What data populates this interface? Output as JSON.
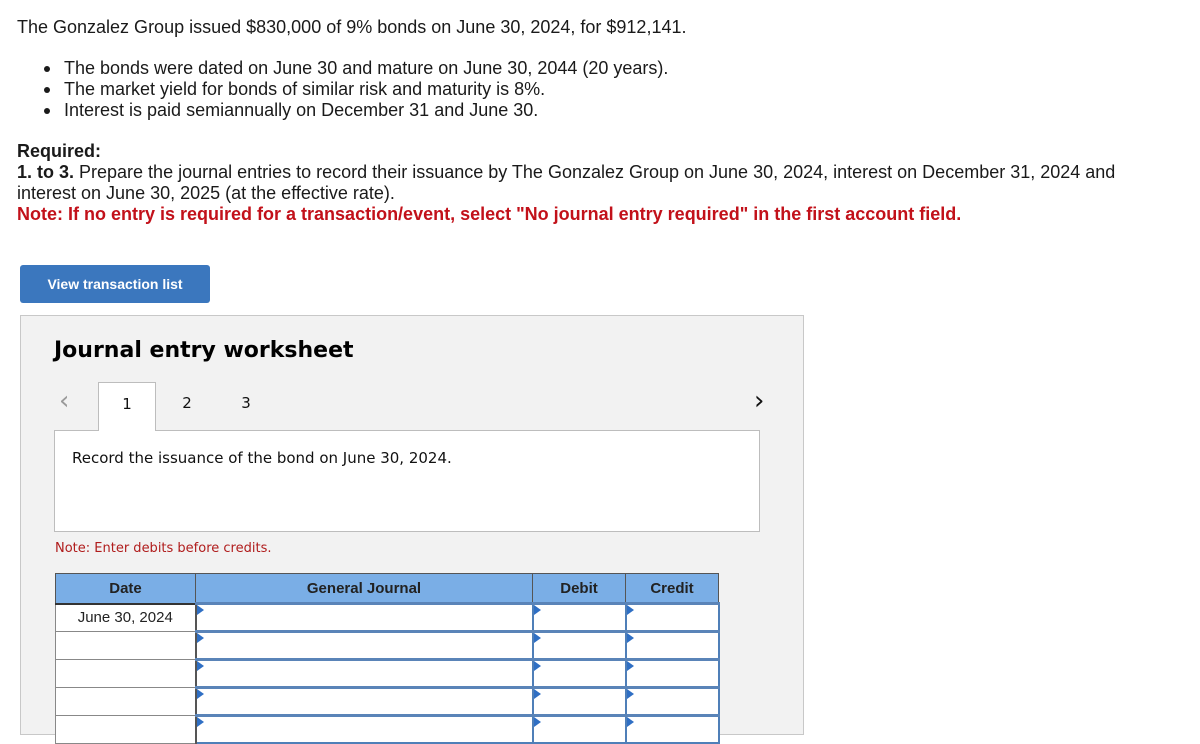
{
  "problem": {
    "intro": "The Gonzalez Group issued $830,000 of 9% bonds on June 30, 2024, for $912,141.",
    "bullets": [
      "The bonds were dated on June 30 and mature on June 30, 2044 (20 years).",
      "The market yield for bonds of similar risk and maturity is 8%.",
      "Interest is paid semiannually on December 31 and June 30."
    ],
    "required_heading": "Required:",
    "step_label": "1. to 3.",
    "step_text": " Prepare the journal entries to record their issuance by The Gonzalez Group on June 30, 2024, interest on December 31, 2024 and interest on June 30, 2025 (at the effective rate).",
    "note": "Note: If no entry is required for a transaction/event, select \"No journal entry required\" in the first account field."
  },
  "view_transaction_button": "View transaction list",
  "worksheet": {
    "title": "Journal entry worksheet",
    "prev_icon": "‹",
    "next_icon": "›",
    "tabs": [
      {
        "label": "1",
        "active": true
      },
      {
        "label": "2",
        "active": false
      },
      {
        "label": "3",
        "active": false
      }
    ],
    "description": "Record the issuance of the bond on June 30, 2024.",
    "note": "Note: Enter debits before credits.",
    "table": {
      "headers": [
        "Date",
        "General Journal",
        "Debit",
        "Credit"
      ],
      "rows": [
        {
          "date": "June 30, 2024",
          "account": "",
          "debit": "",
          "credit": ""
        },
        {
          "date": "",
          "account": "",
          "debit": "",
          "credit": ""
        },
        {
          "date": "",
          "account": "",
          "debit": "",
          "credit": ""
        },
        {
          "date": "",
          "account": "",
          "debit": "",
          "credit": ""
        },
        {
          "date": "",
          "account": "",
          "debit": "",
          "credit": ""
        }
      ]
    }
  },
  "colors": {
    "button_blue": "#3b77be",
    "header_blue": "#7aaee6",
    "note_red": "#c2111a"
  }
}
